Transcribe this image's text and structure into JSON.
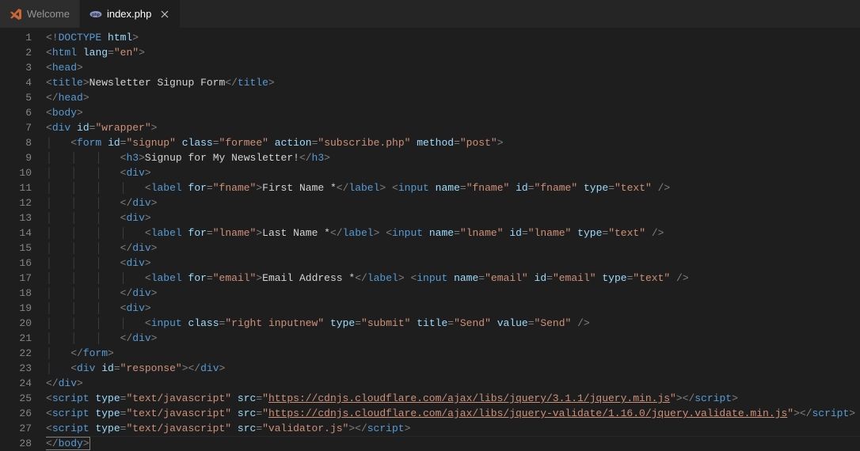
{
  "tabs": [
    {
      "label": "Welcome",
      "icon": "vscode"
    },
    {
      "label": "index.php",
      "icon": "php",
      "active": true
    }
  ],
  "filename": "index.php",
  "lineCount": 28,
  "code": {
    "l1": {
      "indent": 0,
      "tokens": [
        [
          "p",
          "<!"
        ],
        [
          "tg",
          "DOCTYPE"
        ],
        [
          "tx",
          " "
        ],
        [
          "at",
          "html"
        ],
        [
          "p",
          ">"
        ]
      ]
    },
    "l2": {
      "indent": 0,
      "tokens": [
        [
          "p",
          "<"
        ],
        [
          "tg",
          "html"
        ],
        [
          "tx",
          " "
        ],
        [
          "at",
          "lang"
        ],
        [
          "p",
          "="
        ],
        [
          "st",
          "\"en\""
        ],
        [
          "p",
          ">"
        ]
      ]
    },
    "l3": {
      "indent": 0,
      "tokens": [
        [
          "p",
          "<"
        ],
        [
          "tg",
          "head"
        ],
        [
          "p",
          ">"
        ]
      ]
    },
    "l4": {
      "indent": 0,
      "tokens": [
        [
          "p",
          "<"
        ],
        [
          "tg",
          "title"
        ],
        [
          "p",
          ">"
        ],
        [
          "tx",
          "Newsletter Signup Form"
        ],
        [
          "p",
          "</"
        ],
        [
          "tg",
          "title"
        ],
        [
          "p",
          ">"
        ]
      ]
    },
    "l5": {
      "indent": 0,
      "tokens": [
        [
          "p",
          "</"
        ],
        [
          "tg",
          "head"
        ],
        [
          "p",
          ">"
        ]
      ]
    },
    "l6": {
      "indent": 0,
      "tokens": [
        [
          "p",
          "<"
        ],
        [
          "tg",
          "body"
        ],
        [
          "p",
          ">"
        ]
      ]
    },
    "l7": {
      "indent": 0,
      "tokens": [
        [
          "p",
          "<"
        ],
        [
          "tg",
          "div"
        ],
        [
          "tx",
          " "
        ],
        [
          "at",
          "id"
        ],
        [
          "p",
          "="
        ],
        [
          "st",
          "\"wrapper\""
        ],
        [
          "p",
          ">"
        ]
      ]
    },
    "l8": {
      "indent": 1,
      "tokens": [
        [
          "p",
          "<"
        ],
        [
          "tg",
          "form"
        ],
        [
          "tx",
          " "
        ],
        [
          "at",
          "id"
        ],
        [
          "p",
          "="
        ],
        [
          "st",
          "\"signup\""
        ],
        [
          "tx",
          " "
        ],
        [
          "at",
          "class"
        ],
        [
          "p",
          "="
        ],
        [
          "st",
          "\"formee\""
        ],
        [
          "tx",
          " "
        ],
        [
          "at",
          "action"
        ],
        [
          "p",
          "="
        ],
        [
          "st",
          "\"subscribe.php\""
        ],
        [
          "tx",
          " "
        ],
        [
          "at",
          "method"
        ],
        [
          "p",
          "="
        ],
        [
          "st",
          "\"post\""
        ],
        [
          "p",
          ">"
        ]
      ]
    },
    "l9": {
      "indent": 3,
      "tokens": [
        [
          "p",
          "<"
        ],
        [
          "tg",
          "h3"
        ],
        [
          "p",
          ">"
        ],
        [
          "tx",
          "Signup for My Newsletter!"
        ],
        [
          "p",
          "</"
        ],
        [
          "tg",
          "h3"
        ],
        [
          "p",
          ">"
        ]
      ]
    },
    "l10": {
      "indent": 3,
      "tokens": [
        [
          "p",
          "<"
        ],
        [
          "tg",
          "div"
        ],
        [
          "p",
          ">"
        ]
      ]
    },
    "l11": {
      "indent": 4,
      "tokens": [
        [
          "p",
          "<"
        ],
        [
          "tg",
          "label"
        ],
        [
          "tx",
          " "
        ],
        [
          "at",
          "for"
        ],
        [
          "p",
          "="
        ],
        [
          "st",
          "\"fname\""
        ],
        [
          "p",
          ">"
        ],
        [
          "tx",
          "First Name *"
        ],
        [
          "p",
          "</"
        ],
        [
          "tg",
          "label"
        ],
        [
          "p",
          ">"
        ],
        [
          "tx",
          " "
        ],
        [
          "p",
          "<"
        ],
        [
          "tg",
          "input"
        ],
        [
          "tx",
          " "
        ],
        [
          "at",
          "name"
        ],
        [
          "p",
          "="
        ],
        [
          "st",
          "\"fname\""
        ],
        [
          "tx",
          " "
        ],
        [
          "at",
          "id"
        ],
        [
          "p",
          "="
        ],
        [
          "st",
          "\"fname\""
        ],
        [
          "tx",
          " "
        ],
        [
          "at",
          "type"
        ],
        [
          "p",
          "="
        ],
        [
          "st",
          "\"text\""
        ],
        [
          "tx",
          " "
        ],
        [
          "p",
          "/>"
        ]
      ]
    },
    "l12": {
      "indent": 3,
      "tokens": [
        [
          "p",
          "</"
        ],
        [
          "tg",
          "div"
        ],
        [
          "p",
          ">"
        ]
      ]
    },
    "l13": {
      "indent": 3,
      "tokens": [
        [
          "p",
          "<"
        ],
        [
          "tg",
          "div"
        ],
        [
          "p",
          ">"
        ]
      ]
    },
    "l14": {
      "indent": 4,
      "tokens": [
        [
          "p",
          "<"
        ],
        [
          "tg",
          "label"
        ],
        [
          "tx",
          " "
        ],
        [
          "at",
          "for"
        ],
        [
          "p",
          "="
        ],
        [
          "st",
          "\"lname\""
        ],
        [
          "p",
          ">"
        ],
        [
          "tx",
          "Last Name *"
        ],
        [
          "p",
          "</"
        ],
        [
          "tg",
          "label"
        ],
        [
          "p",
          ">"
        ],
        [
          "tx",
          " "
        ],
        [
          "p",
          "<"
        ],
        [
          "tg",
          "input"
        ],
        [
          "tx",
          " "
        ],
        [
          "at",
          "name"
        ],
        [
          "p",
          "="
        ],
        [
          "st",
          "\"lname\""
        ],
        [
          "tx",
          " "
        ],
        [
          "at",
          "id"
        ],
        [
          "p",
          "="
        ],
        [
          "st",
          "\"lname\""
        ],
        [
          "tx",
          " "
        ],
        [
          "at",
          "type"
        ],
        [
          "p",
          "="
        ],
        [
          "st",
          "\"text\""
        ],
        [
          "tx",
          " "
        ],
        [
          "p",
          "/>"
        ]
      ]
    },
    "l15": {
      "indent": 3,
      "tokens": [
        [
          "p",
          "</"
        ],
        [
          "tg",
          "div"
        ],
        [
          "p",
          ">"
        ]
      ]
    },
    "l16": {
      "indent": 3,
      "tokens": [
        [
          "p",
          "<"
        ],
        [
          "tg",
          "div"
        ],
        [
          "p",
          ">"
        ]
      ]
    },
    "l17": {
      "indent": 4,
      "tokens": [
        [
          "p",
          "<"
        ],
        [
          "tg",
          "label"
        ],
        [
          "tx",
          " "
        ],
        [
          "at",
          "for"
        ],
        [
          "p",
          "="
        ],
        [
          "st",
          "\"email\""
        ],
        [
          "p",
          ">"
        ],
        [
          "tx",
          "Email Address *"
        ],
        [
          "p",
          "</"
        ],
        [
          "tg",
          "label"
        ],
        [
          "p",
          ">"
        ],
        [
          "tx",
          " "
        ],
        [
          "p",
          "<"
        ],
        [
          "tg",
          "input"
        ],
        [
          "tx",
          " "
        ],
        [
          "at",
          "name"
        ],
        [
          "p",
          "="
        ],
        [
          "st",
          "\"email\""
        ],
        [
          "tx",
          " "
        ],
        [
          "at",
          "id"
        ],
        [
          "p",
          "="
        ],
        [
          "st",
          "\"email\""
        ],
        [
          "tx",
          " "
        ],
        [
          "at",
          "type"
        ],
        [
          "p",
          "="
        ],
        [
          "st",
          "\"text\""
        ],
        [
          "tx",
          " "
        ],
        [
          "p",
          "/>"
        ]
      ]
    },
    "l18": {
      "indent": 3,
      "tokens": [
        [
          "p",
          "</"
        ],
        [
          "tg",
          "div"
        ],
        [
          "p",
          ">"
        ]
      ]
    },
    "l19": {
      "indent": 3,
      "tokens": [
        [
          "p",
          "<"
        ],
        [
          "tg",
          "div"
        ],
        [
          "p",
          ">"
        ]
      ]
    },
    "l20": {
      "indent": 4,
      "tokens": [
        [
          "p",
          "<"
        ],
        [
          "tg",
          "input"
        ],
        [
          "tx",
          " "
        ],
        [
          "at",
          "class"
        ],
        [
          "p",
          "="
        ],
        [
          "st",
          "\"right inputnew\""
        ],
        [
          "tx",
          " "
        ],
        [
          "at",
          "type"
        ],
        [
          "p",
          "="
        ],
        [
          "st",
          "\"submit\""
        ],
        [
          "tx",
          " "
        ],
        [
          "at",
          "title"
        ],
        [
          "p",
          "="
        ],
        [
          "st",
          "\"Send\""
        ],
        [
          "tx",
          " "
        ],
        [
          "at",
          "value"
        ],
        [
          "p",
          "="
        ],
        [
          "st",
          "\"Send\""
        ],
        [
          "tx",
          " "
        ],
        [
          "p",
          "/>"
        ]
      ]
    },
    "l21": {
      "indent": 3,
      "tokens": [
        [
          "p",
          "</"
        ],
        [
          "tg",
          "div"
        ],
        [
          "p",
          ">"
        ]
      ]
    },
    "l22": {
      "indent": 1,
      "tokens": [
        [
          "p",
          "</"
        ],
        [
          "tg",
          "form"
        ],
        [
          "p",
          ">"
        ]
      ]
    },
    "l23": {
      "indent": 1,
      "tokens": [
        [
          "p",
          "<"
        ],
        [
          "tg",
          "div"
        ],
        [
          "tx",
          " "
        ],
        [
          "at",
          "id"
        ],
        [
          "p",
          "="
        ],
        [
          "st",
          "\"response\""
        ],
        [
          "p",
          "></"
        ],
        [
          "tg",
          "div"
        ],
        [
          "p",
          ">"
        ]
      ]
    },
    "l24": {
      "indent": 0,
      "tokens": [
        [
          "p",
          "</"
        ],
        [
          "tg",
          "div"
        ],
        [
          "p",
          ">"
        ]
      ]
    },
    "l25": {
      "indent": 0,
      "tokens": [
        [
          "p",
          "<"
        ],
        [
          "tg",
          "script"
        ],
        [
          "tx",
          " "
        ],
        [
          "at",
          "type"
        ],
        [
          "p",
          "="
        ],
        [
          "st",
          "\"text/javascript\""
        ],
        [
          "tx",
          " "
        ],
        [
          "at",
          "src"
        ],
        [
          "p",
          "="
        ],
        [
          "st",
          "\""
        ],
        [
          "st ul",
          "https://cdnjs.cloudflare.com/ajax/libs/jquery/3.1.1/jquery.min.js"
        ],
        [
          "st",
          "\""
        ],
        [
          "p",
          "></"
        ],
        [
          "tg",
          "script"
        ],
        [
          "p",
          ">"
        ]
      ]
    },
    "l26": {
      "indent": 0,
      "tokens": [
        [
          "p",
          "<"
        ],
        [
          "tg",
          "script"
        ],
        [
          "tx",
          " "
        ],
        [
          "at",
          "type"
        ],
        [
          "p",
          "="
        ],
        [
          "st",
          "\"text/javascript\""
        ],
        [
          "tx",
          " "
        ],
        [
          "at",
          "src"
        ],
        [
          "p",
          "="
        ],
        [
          "st",
          "\""
        ],
        [
          "st ul",
          "https://cdnjs.cloudflare.com/ajax/libs/jquery-validate/1.16.0/jquery.validate.min.js"
        ],
        [
          "st",
          "\""
        ],
        [
          "p",
          "></"
        ],
        [
          "tg",
          "script"
        ],
        [
          "p",
          ">"
        ]
      ]
    },
    "l27": {
      "indent": 0,
      "tokens": [
        [
          "p",
          "<"
        ],
        [
          "tg",
          "script"
        ],
        [
          "tx",
          " "
        ],
        [
          "at",
          "type"
        ],
        [
          "p",
          "="
        ],
        [
          "st",
          "\"text/javascript\""
        ],
        [
          "tx",
          " "
        ],
        [
          "at",
          "src"
        ],
        [
          "p",
          "="
        ],
        [
          "st",
          "\"validator.js\""
        ],
        [
          "p",
          "></"
        ],
        [
          "tg",
          "script"
        ],
        [
          "p",
          ">"
        ]
      ]
    },
    "l28": {
      "indent": 0,
      "cursor": true,
      "tokens": [
        [
          "p",
          "</"
        ],
        [
          "tg",
          "body"
        ],
        [
          "p",
          ">"
        ]
      ]
    }
  }
}
